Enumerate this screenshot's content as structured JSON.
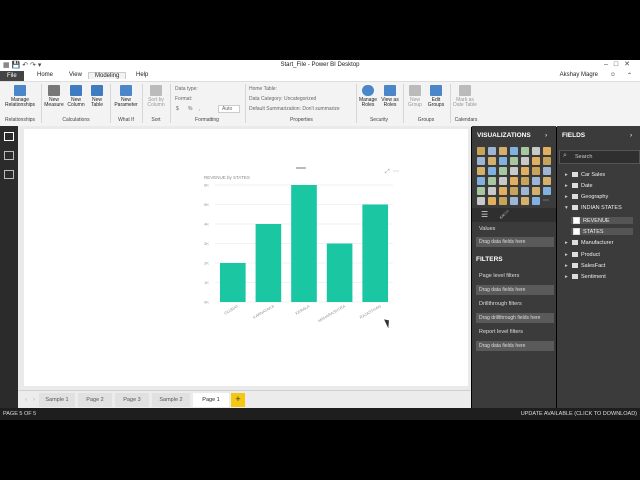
{
  "window": {
    "title": "Start_File - Power BI Desktop",
    "user": "Akshay Magre",
    "controls": [
      "–",
      "□",
      "✕"
    ]
  },
  "menu": {
    "file": "File",
    "tabs": [
      "Home",
      "View",
      "Modeling",
      "Help"
    ],
    "active_tab": "Modeling"
  },
  "ribbon": {
    "relationships": {
      "manage": "Manage Relationships",
      "group": "Relationships"
    },
    "calculations": {
      "new_measure": "New Measure",
      "new_column": "New Column",
      "new_table": "New Table",
      "group": "Calculations"
    },
    "whatif": {
      "new_parameter": "New Parameter",
      "group": "What If"
    },
    "sort": {
      "sort_by_column": "Sort by Column",
      "group": "Sort"
    },
    "formatting": {
      "data_type": "Data type:",
      "format": "Format:",
      "currency": "$",
      "percent": "%",
      "comma": ",",
      "auto": "Auto",
      "group": "Formatting"
    },
    "properties": {
      "home_table": "Home Table:",
      "data_category": "Data Category: Uncategorized",
      "default_summarization": "Default Summarization: Don't summarize",
      "group": "Properties"
    },
    "security": {
      "manage_roles": "Manage Roles",
      "view_as_roles": "View as Roles",
      "group": "Security"
    },
    "groups": {
      "new_group": "New Group",
      "edit_groups": "Edit Groups",
      "group": "Groups"
    },
    "calendars": {
      "mark_as_date_table": "Mark as Date Table",
      "group": "Calendars"
    }
  },
  "pages": {
    "tabs": [
      "Sample 1",
      "Page 2",
      "Page 3",
      "Sample 2",
      "Page 1"
    ],
    "active": "Page 1",
    "add": "+"
  },
  "visualizations": {
    "header": "VISUALIZATIONS",
    "values_label": "Values",
    "values_placeholder": "Drag data fields here",
    "filters_header": "FILTERS",
    "page_level": "Page level filters",
    "page_level_placeholder": "Drag data fields here",
    "drillthrough": "Drillthrough filters",
    "drillthrough_placeholder": "Drag drillthrough fields here",
    "report_level": "Report level filters",
    "report_level_placeholder": "Drag data fields here"
  },
  "fields": {
    "header": "FIELDS",
    "search_placeholder": "Search",
    "tables": [
      "Car Sales",
      "Date",
      "Geography",
      "INDIAN STATES",
      "Manufacturer",
      "Product",
      "SalesFact",
      "Sentiment"
    ],
    "expanded_table": "INDIAN STATES",
    "expanded_fields": [
      "REVENUE",
      "STATES"
    ]
  },
  "status": {
    "page_count": "PAGE 5 OF 5",
    "update": "UPDATE AVAILABLE (CLICK TO DOWNLOAD)"
  },
  "colors": {
    "bar": "#1bc7a3",
    "accent": "#f2c811"
  },
  "chart_data": {
    "type": "bar",
    "title": "REVENUE by STATES",
    "categories": [
      "GUJRAT",
      "KARNATAKA",
      "KERALA",
      "MAHARASHTRA",
      "RAJASTHAN"
    ],
    "values": [
      2,
      4,
      6,
      3,
      5
    ],
    "ylim": [
      0,
      6
    ],
    "yticks": [
      "0K",
      "1K",
      "2K",
      "3K",
      "4K",
      "5K",
      "6K"
    ],
    "xlabel": "",
    "ylabel": "",
    "grid": true
  }
}
